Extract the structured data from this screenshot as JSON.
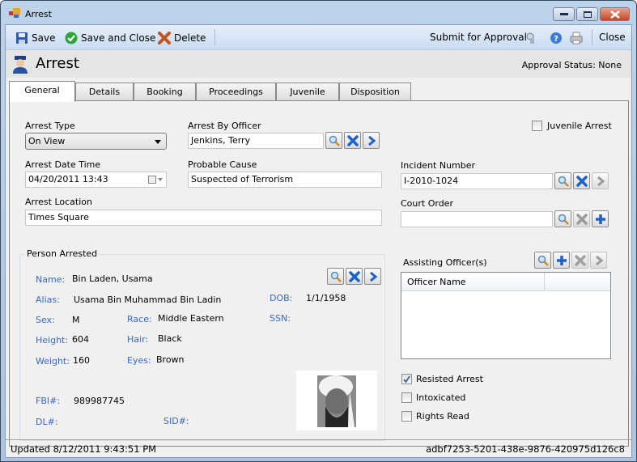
{
  "window": {
    "title": "Arrest"
  },
  "toolbar": {
    "save": "Save",
    "save_and_close": "Save and Close",
    "delete": "Delete",
    "submit_for_approval": "Submit for Approval",
    "close": "Close"
  },
  "header": {
    "title": "Arrest",
    "approval_status": "Approval Status: None"
  },
  "tabs": [
    {
      "label": "General",
      "active": true
    },
    {
      "label": "Details"
    },
    {
      "label": "Booking"
    },
    {
      "label": "Proceedings"
    },
    {
      "label": "Juvenile"
    },
    {
      "label": "Disposition"
    }
  ],
  "form": {
    "arrest_type": {
      "label": "Arrest Type",
      "value": "On View"
    },
    "arrest_by_officer": {
      "label": "Arrest By Officer",
      "value": "Jenkins, Terry"
    },
    "juvenile_arrest": {
      "label": "Juvenile Arrest",
      "checked": false
    },
    "arrest_date_time": {
      "label": "Arrest Date Time",
      "value": "04/20/2011 13:43"
    },
    "probable_cause": {
      "label": "Probable Cause",
      "value": "Suspected of Terrorism"
    },
    "incident_number": {
      "label": "Incident Number",
      "value": "I-2010-1024"
    },
    "arrest_location": {
      "label": "Arrest Location",
      "value": "Times Square"
    },
    "court_order": {
      "label": "Court Order",
      "value": ""
    }
  },
  "person": {
    "group_title": "Person Arrested",
    "labels": {
      "name": "Name:",
      "alias": "Alias:",
      "dob": "DOB:",
      "sex": "Sex:",
      "race": "Race:",
      "ssn": "SSN:",
      "height": "Height:",
      "hair": "Hair:",
      "weight": "Weight:",
      "eyes": "Eyes:",
      "fbi": "FBI#:",
      "dl": "DL#:",
      "sid": "SID#:"
    },
    "name": "Bin Laden, Usama",
    "alias": "Usama Bin Muhammad Bin Ladin",
    "dob": "1/1/1958",
    "sex": "M",
    "race": "Middle Eastern",
    "ssn": "",
    "height": "604",
    "hair": "Black",
    "weight": "160",
    "eyes": "Brown",
    "fbi": "989987745",
    "dl": "",
    "sid": ""
  },
  "assisting": {
    "label": "Assisting Officer(s)",
    "columns": [
      "Officer Name",
      ""
    ],
    "rows": []
  },
  "flags": {
    "resisted_arrest": {
      "label": "Resisted Arrest",
      "checked": true
    },
    "intoxicated": {
      "label": "Intoxicated",
      "checked": false
    },
    "rights_read": {
      "label": "Rights Read",
      "checked": false
    }
  },
  "status": {
    "updated": "Updated 8/12/2011 9:43:51 PM",
    "record_id": "adbf7253-5201-438e-9876-420975d126c8"
  }
}
